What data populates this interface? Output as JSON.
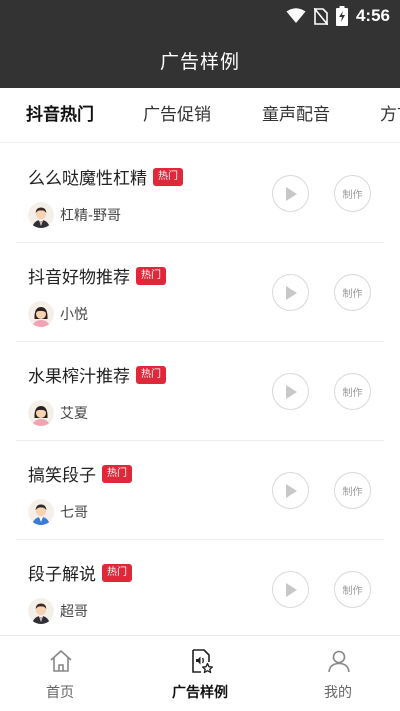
{
  "status_bar": {
    "time": "4:56"
  },
  "header": {
    "title": "广告样例"
  },
  "tabs": [
    {
      "label": "抖音热门"
    },
    {
      "label": "广告促销"
    },
    {
      "label": "童声配音"
    },
    {
      "label": "方言"
    }
  ],
  "items": [
    {
      "title": "么么哒魔性杠精",
      "badge": "热门",
      "author": "杠精-野哥",
      "avatar": "male-suit-avatar",
      "make_label": "制作"
    },
    {
      "title": "抖音好物推荐",
      "badge": "热门",
      "author": "小悦",
      "avatar": "female-avatar",
      "make_label": "制作"
    },
    {
      "title": "水果榨汁推荐",
      "badge": "热门",
      "author": "艾夏",
      "avatar": "female-avatar",
      "make_label": "制作"
    },
    {
      "title": "搞笑段子",
      "badge": "热门",
      "author": "七哥",
      "avatar": "male-blue-avatar",
      "make_label": "制作"
    },
    {
      "title": "段子解说",
      "badge": "热门",
      "author": "超哥",
      "avatar": "male-suit-avatar",
      "make_label": "制作"
    }
  ],
  "bottom_nav": [
    {
      "label": "首页",
      "icon": "home-icon"
    },
    {
      "label": "广告样例",
      "icon": "audio-file-icon"
    },
    {
      "label": "我的",
      "icon": "user-icon"
    }
  ],
  "colors": {
    "header_bg": "#333333",
    "badge": "#e0283b",
    "accent_active": "#111111"
  }
}
